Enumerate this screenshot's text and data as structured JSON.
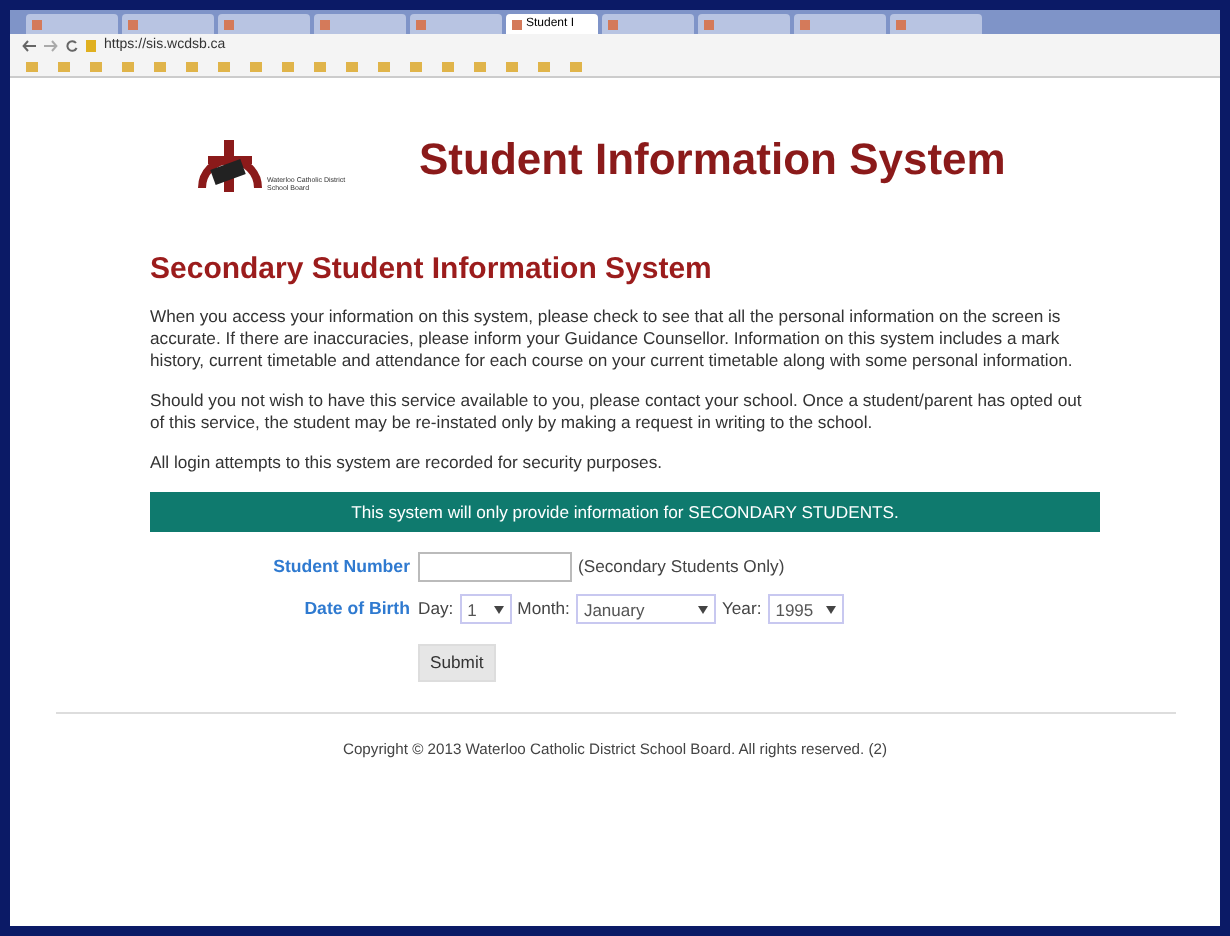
{
  "browser": {
    "tabs": [
      {
        "selected": false
      },
      {
        "selected": false
      },
      {
        "selected": false
      },
      {
        "selected": false
      },
      {
        "selected": false
      },
      {
        "label": "Student I",
        "selected": true
      },
      {
        "selected": false
      },
      {
        "selected": false
      },
      {
        "selected": false
      },
      {
        "selected": false
      }
    ],
    "url": "https://sis.wcdsb.ca"
  },
  "header": {
    "logo_text": "Waterloo Catholic District School Board",
    "title": "Student Information System"
  },
  "heading": "Secondary Student Information System",
  "paragraphs": [
    "When you access your information on this system, please check to see that all the personal information on the screen is accurate. If there are inaccuracies, please inform your Guidance Counsellor. Information on this system includes a mark history, current timetable and attendance for each course on your current timetable along with some personal information.",
    "Should you not wish to have this service available to you, please contact your school. Once a student/parent has opted out of this service, the student may be re-instated only by making a request in writing to the school.",
    "All login attempts to this system are recorded for security purposes."
  ],
  "banner": "This system will only provide information for SECONDARY STUDENTS.",
  "form": {
    "student_number": {
      "label": "Student Number",
      "note": "(Secondary Students Only)"
    },
    "dob": {
      "label": "Date of Birth",
      "day_label": "Day:",
      "day": "1",
      "month_label": "Month:",
      "month": "January",
      "year_label": "Year:",
      "year": "1995"
    },
    "submit": "Submit"
  },
  "footer": "Copyright © 2013 Waterloo Catholic District School Board. All rights reserved. (2)"
}
